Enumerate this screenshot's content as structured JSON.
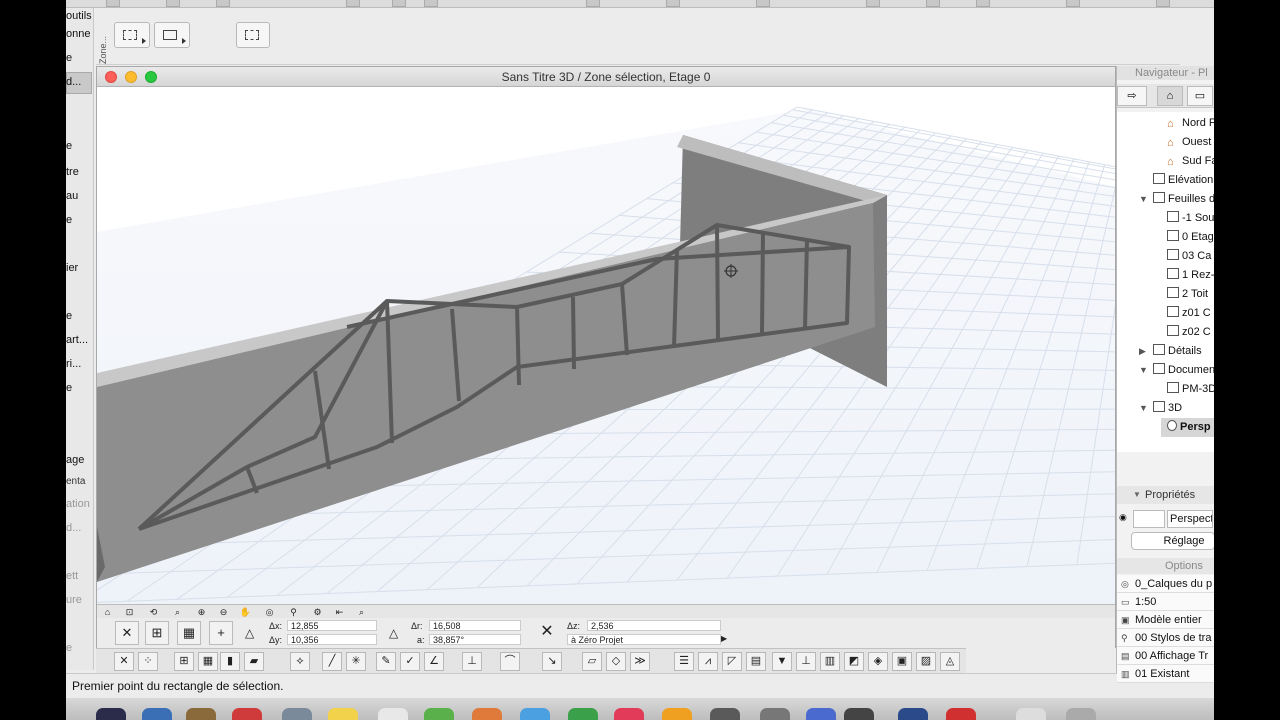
{
  "left_panel": {
    "labels": [
      "outils",
      "onne",
      "e",
      "d...",
      "e",
      "tre",
      "au",
      "e",
      "ier",
      "e",
      "art...",
      "ri...",
      "e",
      "age",
      "enta",
      "ation",
      "d...",
      "ett",
      "ure",
      "e"
    ]
  },
  "zone_toolbar": {
    "vertical_label": "Zone..."
  },
  "window": {
    "title": "Sans Titre 3D / Zone sélection, Etage 0"
  },
  "coords": {
    "dx_label": "Δx:",
    "dx_value": "12,855",
    "dy_label": "Δy:",
    "dy_value": "10,356",
    "dr_label": "Δr:",
    "dr_value": "16,508",
    "a_label": "a:",
    "a_value": "38,857°",
    "dz_label": "Δz:",
    "dz_value": "2,536",
    "ref_label": "à Zéro Projet"
  },
  "status": {
    "message": "Premier point du rectangle de sélection."
  },
  "navigator": {
    "title": "Navigateur - Pl",
    "tree": [
      {
        "label": "Nord F",
        "icon": "house-icon"
      },
      {
        "label": "Ouest",
        "icon": "house-icon"
      },
      {
        "label": "Sud Fa",
        "icon": "house-icon"
      },
      {
        "label": "Elévation",
        "icon": "elevation-icon"
      },
      {
        "label": "Feuilles d",
        "icon": "worksheet-icon"
      },
      {
        "label": "-1 Sou",
        "icon": "worksheet-icon"
      },
      {
        "label": "0 Etag",
        "icon": "worksheet-icon"
      },
      {
        "label": "03 Ca",
        "icon": "worksheet-icon"
      },
      {
        "label": "1 Rez-",
        "icon": "worksheet-icon"
      },
      {
        "label": "2 Toit",
        "icon": "worksheet-icon"
      },
      {
        "label": "z01 C",
        "icon": "worksheet-icon"
      },
      {
        "label": "z02 C",
        "icon": "worksheet-icon"
      },
      {
        "label": "Détails",
        "icon": "details-icon"
      },
      {
        "label": "Documen",
        "icon": "document-icon"
      },
      {
        "label": "PM-3D",
        "icon": "document-icon"
      },
      {
        "label": "3D",
        "icon": "3d-icon"
      },
      {
        "label": "Persp",
        "icon": "camera-icon"
      }
    ],
    "properties_title": "Propriétés",
    "properties_name": "Perspect",
    "settings_button": "Réglage",
    "options_title": "Options m",
    "options": [
      "0_Calques du p",
      "1:50",
      "Modèle entier",
      "00 Stylos de tra",
      "00 Affichage Tr",
      "01 Existant"
    ]
  },
  "colors": {
    "wall": "#8f8f8f",
    "wall_top": "#c9c9c9",
    "grid": "#dde4ee",
    "ground": "#f4f7fc",
    "frame": "#5d5d5d"
  }
}
